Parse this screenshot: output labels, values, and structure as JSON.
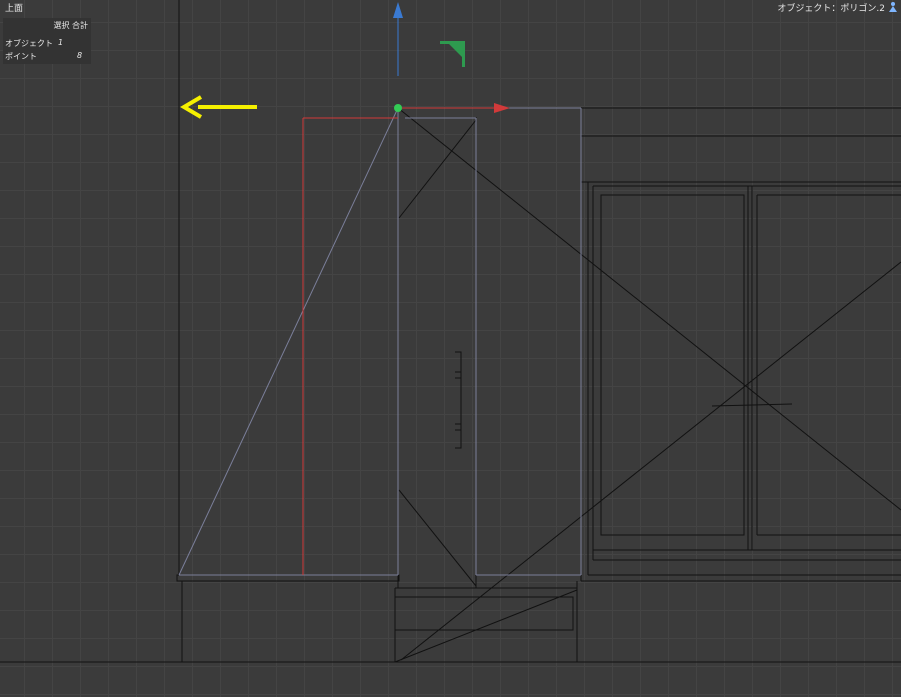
{
  "viewport": {
    "view_name": "上面",
    "object_name": "オブジェクト：ポリゴン.2"
  },
  "info_panel": {
    "header": "選択 合計",
    "rows": [
      {
        "label": "オブジェクト",
        "selected": "1",
        "total": ""
      },
      {
        "label": "ポイント",
        "selected": "",
        "total": "8"
      }
    ]
  },
  "colors": {
    "background": "#3b3b3b",
    "grid": "#444444",
    "wire": "#111111",
    "selected_edge": "#7b7f9a",
    "x_axis": "#d23a3a",
    "y_axis": "#3a7ad2",
    "handle_point": "#33cc55",
    "annotation_arrow": "#f5f000",
    "view_gizmo": "#2e9a4f"
  },
  "icons": {
    "object_icon": "person-icon",
    "annotation": "arrow-left-icon",
    "gizmo": "axis-gizmo-icon"
  }
}
